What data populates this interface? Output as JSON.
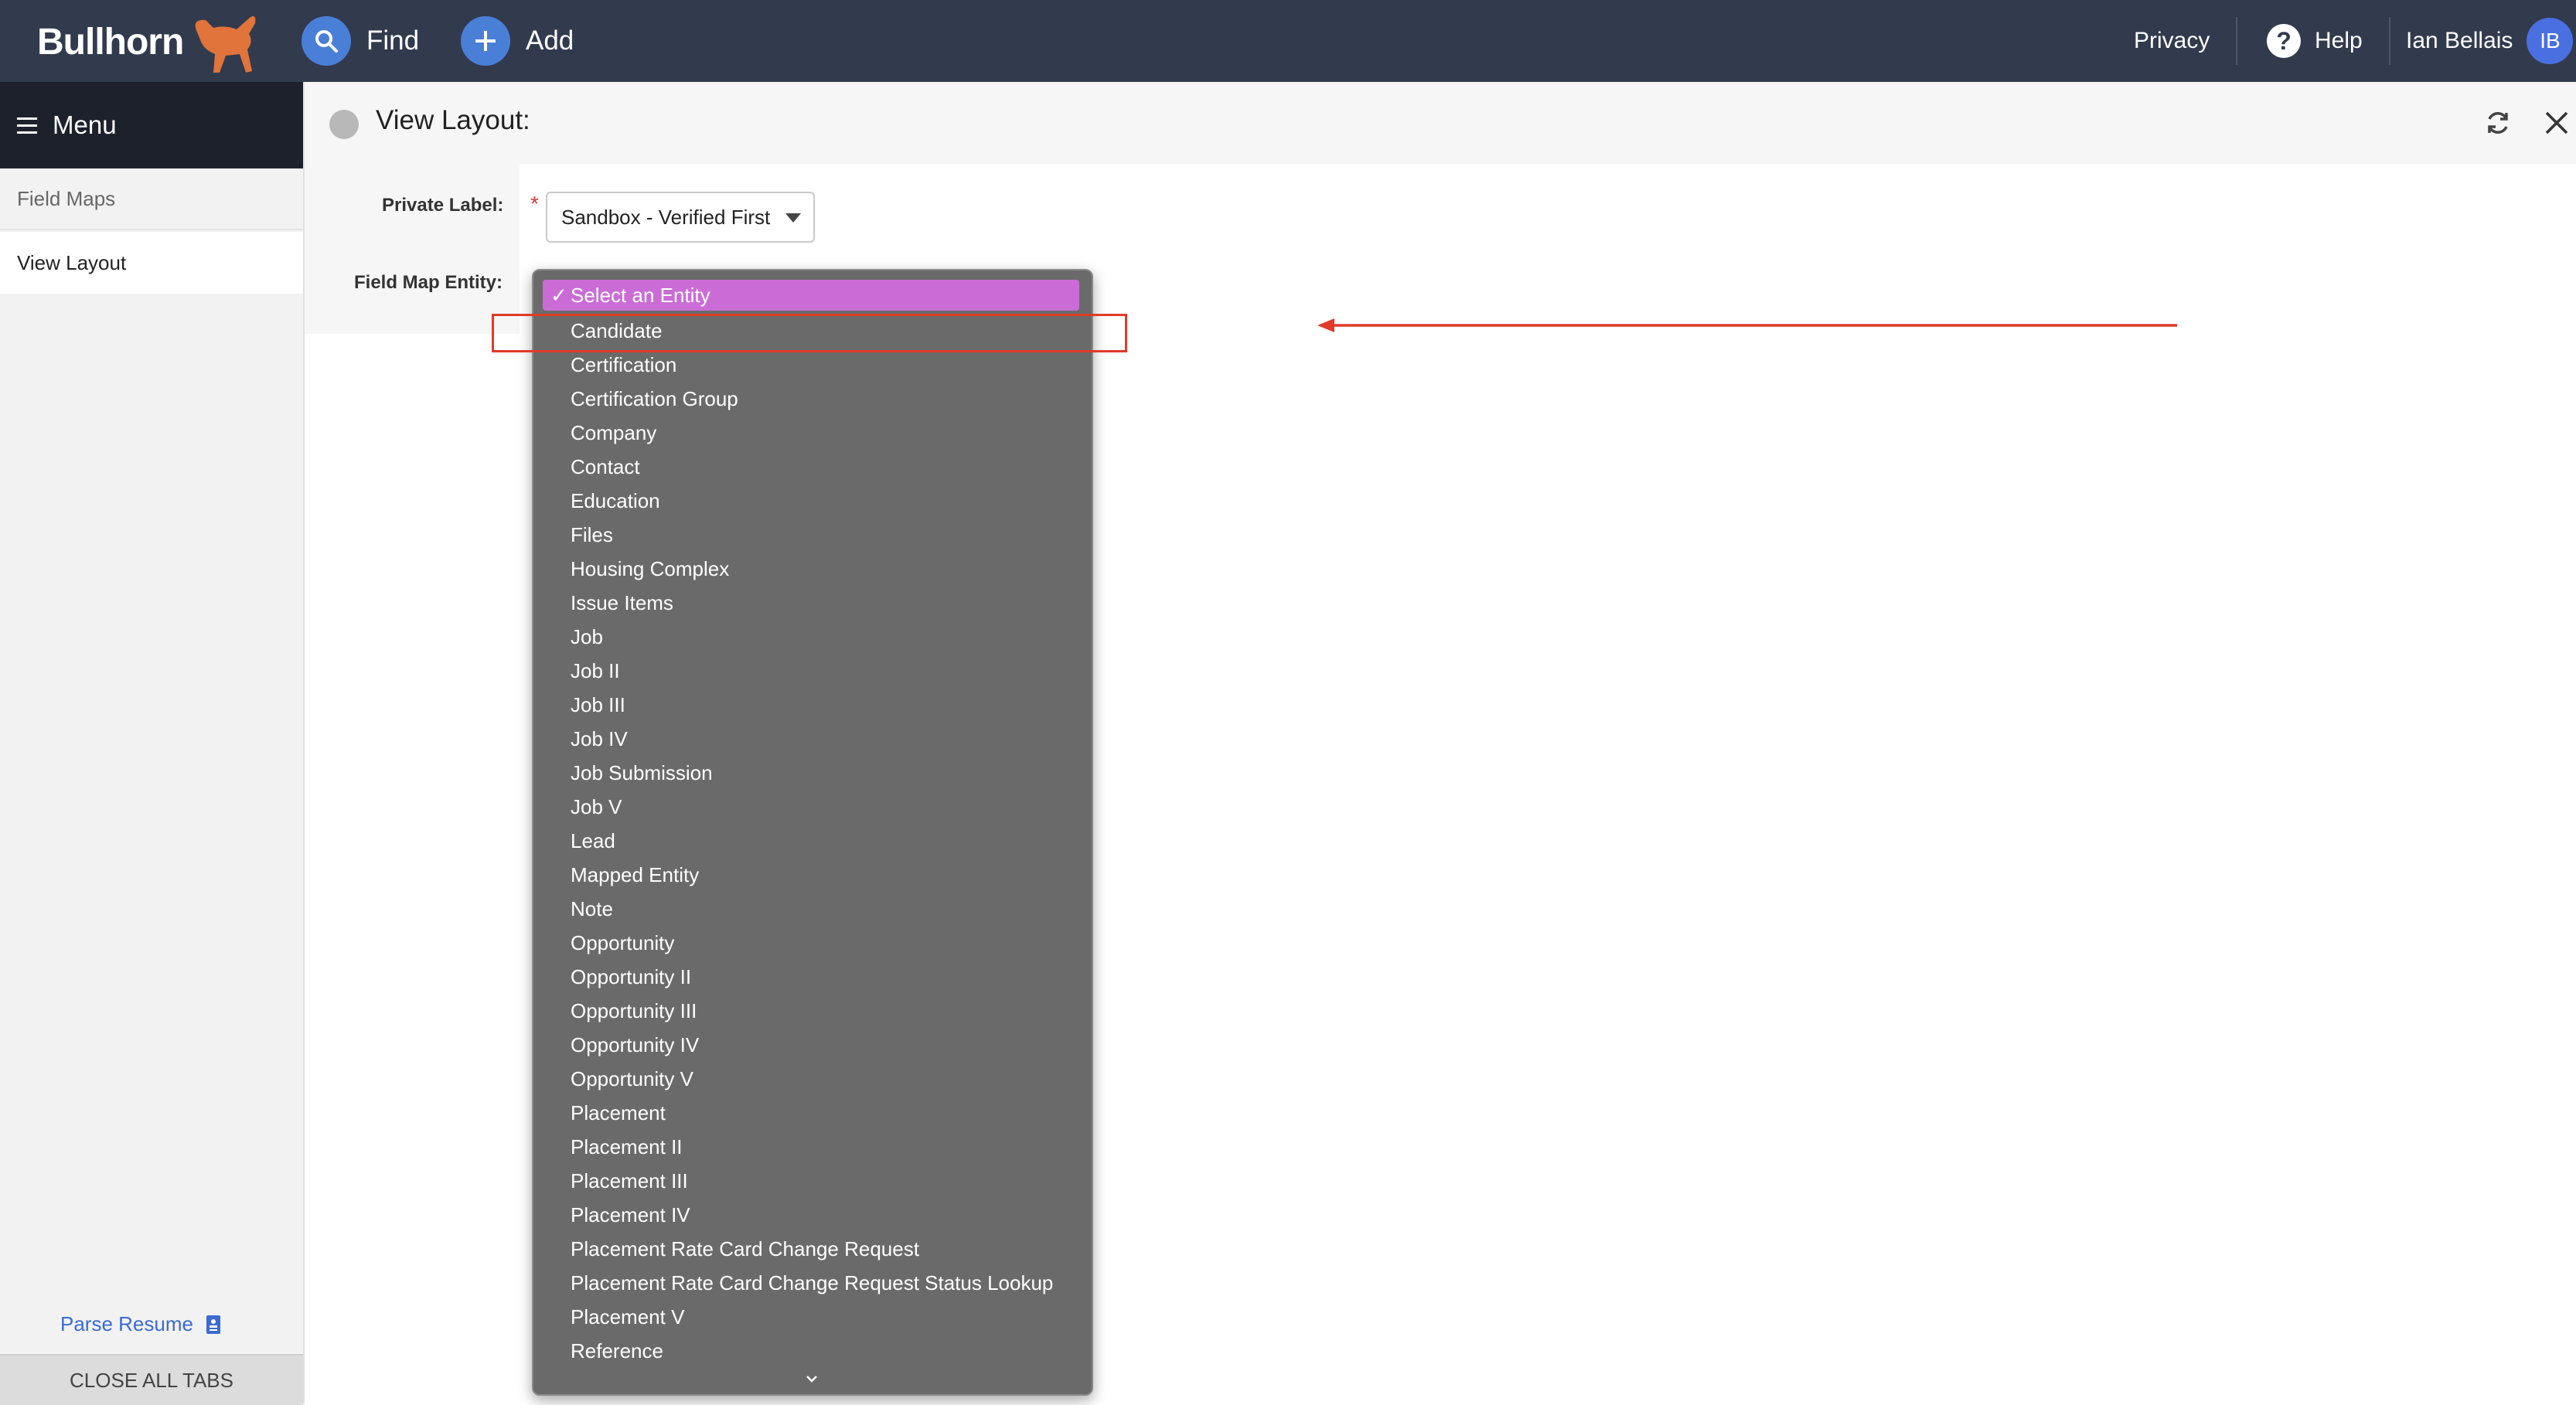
{
  "topbar": {
    "brand": "Bullhorn",
    "find_label": "Find",
    "add_label": "Add",
    "privacy_label": "Privacy",
    "help_label": "Help",
    "user_name": "Ian Bellais",
    "user_initials": "IB"
  },
  "sidebar": {
    "menu_label": "Menu",
    "items": [
      {
        "label": "Field Maps"
      },
      {
        "label": "View Layout"
      }
    ],
    "parse_resume_label": "Parse Resume",
    "close_all_tabs_label": "CLOSE ALL TABS"
  },
  "header": {
    "title": "View Layout:"
  },
  "form": {
    "private_label_label": "Private Label:",
    "required_marker": "*",
    "private_label_value": "Sandbox - Verified First",
    "field_map_entity_label": "Field Map Entity:"
  },
  "entity_dropdown": {
    "selected": "Select an Entity",
    "check_mark": "✓",
    "options": [
      "Candidate",
      "Certification",
      "Certification Group",
      "Company",
      "Contact",
      "Education",
      "Files",
      "Housing Complex",
      "Issue Items",
      "Job",
      "Job II",
      "Job III",
      "Job IV",
      "Job Submission",
      "Job V",
      "Lead",
      "Mapped Entity",
      "Note",
      "Opportunity",
      "Opportunity II",
      "Opportunity III",
      "Opportunity IV",
      "Opportunity V",
      "Placement",
      "Placement II",
      "Placement III",
      "Placement IV",
      "Placement Rate Card Change Request",
      "Placement Rate Card Change Request Status Lookup",
      "Placement V",
      "Reference"
    ],
    "highlighted_option": "Candidate",
    "colors": {
      "list_bg": "#6a6a6a",
      "selected_bg": "#cb6cd6",
      "annotation": "#e03a2a"
    }
  },
  "icons": [
    "search-icon",
    "plus-icon",
    "help-icon",
    "menu-icon",
    "refresh-icon",
    "close-icon",
    "document-icon",
    "chevron-down-icon",
    "bull-logo-icon"
  ]
}
